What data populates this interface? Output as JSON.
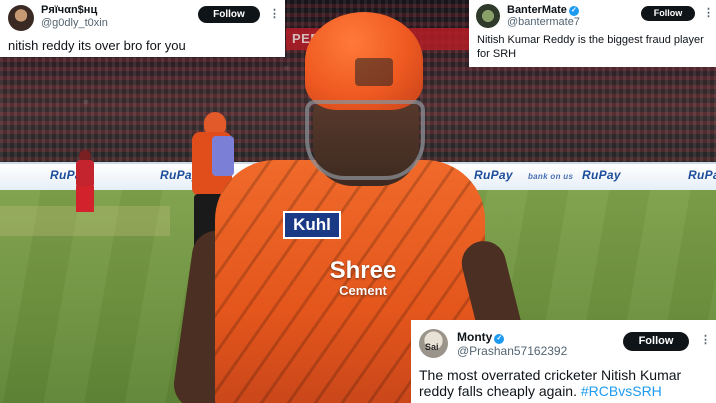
{
  "scene": {
    "stadium_sign": "PEPSI",
    "board_brand": "RuPay",
    "board_small": "bank on us",
    "jersey_sponsor_1": "Kuhl",
    "jersey_sponsor_2_line1": "Shree",
    "jersey_sponsor_2_line2": "Cement"
  },
  "tweets": [
    {
      "name": "Pяïчαn$нц",
      "handle": "@g0dly_t0xin",
      "verified": false,
      "follow_label": "Follow",
      "more": "⋮",
      "text": "nitish reddy its over bro for you"
    },
    {
      "name": "BanterMate",
      "handle": "@bantermate7",
      "verified": true,
      "follow_label": "Follow",
      "more": "⋮",
      "text": "Nitish Kumar Reddy is the biggest fraud player for SRH"
    },
    {
      "name": "Monty",
      "handle": "@Prashan57162392",
      "verified": true,
      "follow_label": "Follow",
      "more": "⋮",
      "avatar_text": "Sai",
      "text": "The most overrated cricketer Nitish Kumar reddy falls cheaply again.",
      "hashtag": "#RCBvsSRH"
    }
  ],
  "colors": {
    "follow_button": "#0f1419",
    "verified_badge": "#1d9bf0",
    "hashtag": "#1d9bf0",
    "srh_orange": "#ef5a21"
  },
  "icons": {
    "verified": "verified-badge-icon",
    "more": "more-options-icon"
  }
}
